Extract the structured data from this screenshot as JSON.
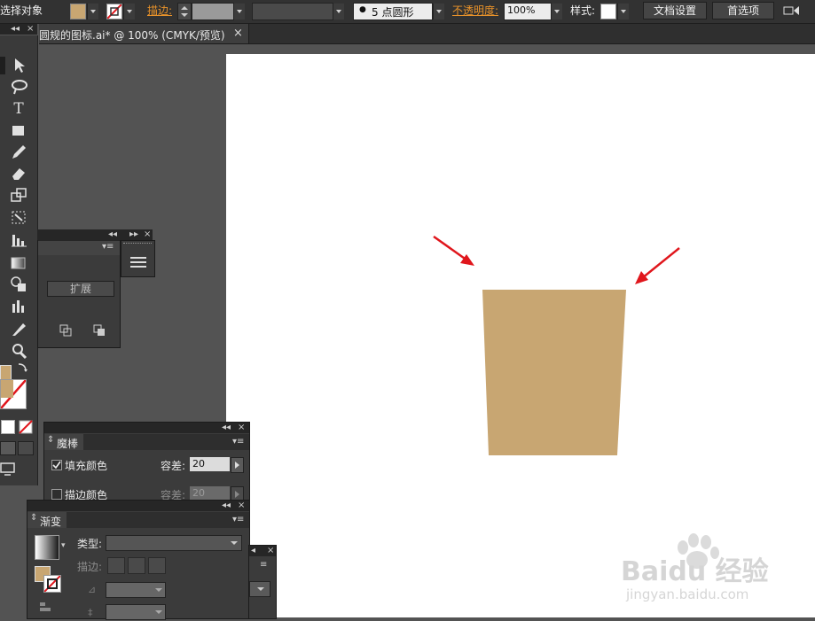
{
  "control_bar": {
    "selection_label": "选择对象",
    "stroke_label": "描边:",
    "brush_value": "5 点圆形",
    "opacity_label": "不透明度:",
    "opacity_value": "100%",
    "style_label": "样式:",
    "doc_setup_label": "文档设置",
    "preferences_label": "首选项"
  },
  "document_tab": {
    "title": "圆规的图标.ai* @ 100% (CMYK/预览)",
    "close": "×"
  },
  "panels": {
    "pathfinder": {
      "expand_label": "扩展"
    },
    "magic_wand": {
      "title": "魔棒",
      "fill_color_label": "填充颜色",
      "fill_color_checked": true,
      "fill_tolerance_label": "容差:",
      "fill_tolerance_value": "20",
      "stroke_color_label": "描边颜色",
      "stroke_color_checked": false,
      "stroke_tolerance_label": "容差:",
      "stroke_tolerance_value": "20"
    },
    "gradient": {
      "title": "渐变",
      "type_label": "类型:",
      "stroke_label": "描边:"
    }
  },
  "canvas": {
    "shape_fill": "#c8a672",
    "arrow_color": "#e0161c"
  },
  "colors": {
    "fill_swatch": "#c8a672",
    "accent_orange": "#e8922a"
  },
  "watermark": {
    "brand": "Baidu 经验",
    "url": "jingyan.baidu.com"
  }
}
